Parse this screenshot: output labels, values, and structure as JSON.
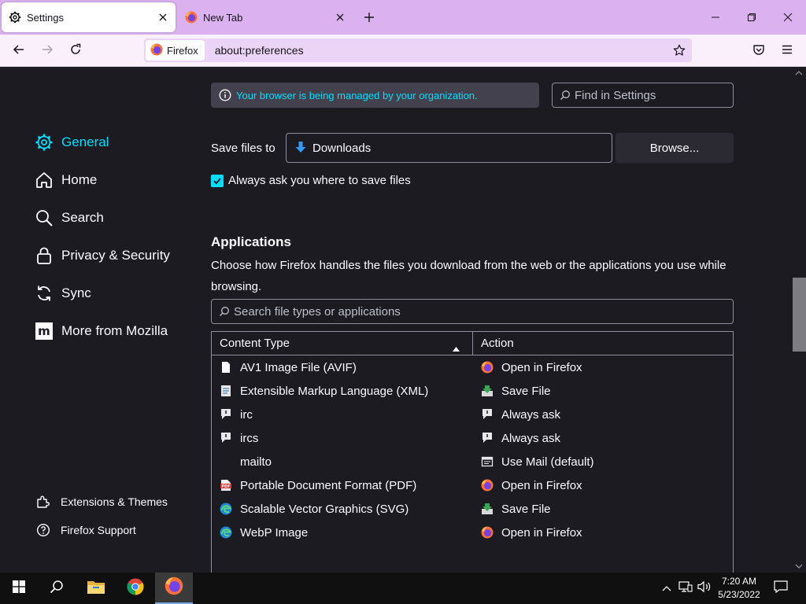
{
  "tabs": [
    {
      "label": "Settings",
      "icon": "gear-icon"
    },
    {
      "label": "New Tab",
      "icon": "firefox-icon"
    }
  ],
  "urlbar": {
    "identity_label": "Firefox",
    "url": "about:preferences"
  },
  "sidebar": {
    "items": [
      {
        "label": "General",
        "icon": "gear-icon",
        "selected": true
      },
      {
        "label": "Home",
        "icon": "home-icon"
      },
      {
        "label": "Search",
        "icon": "search-icon"
      },
      {
        "label": "Privacy & Security",
        "icon": "lock-icon"
      },
      {
        "label": "Sync",
        "icon": "sync-icon"
      },
      {
        "label": "More from Mozilla",
        "icon": "mozilla-icon"
      }
    ],
    "footer": [
      {
        "label": "Extensions & Themes",
        "icon": "puzzle-icon"
      },
      {
        "label": "Firefox Support",
        "icon": "help-icon"
      }
    ]
  },
  "policies_notice": "Your browser is being managed by your organization.",
  "find_placeholder": "Find in Settings",
  "downloads": {
    "save_label": "Save files to",
    "folder": "Downloads",
    "browse_label": "Browse...",
    "always_ask_label": "Always ask you where to save files",
    "always_ask_checked": true
  },
  "applications": {
    "title": "Applications",
    "description": "Choose how Firefox handles the files you download from the web or the applications you use while browsing.",
    "search_placeholder": "Search file types or applications",
    "headers": {
      "content_type": "Content Type",
      "action": "Action"
    },
    "rows": [
      {
        "type": "AV1 Image File (AVIF)",
        "type_icon": "file-icon",
        "action": "Open in Firefox",
        "action_icon": "firefox-icon"
      },
      {
        "type": "Extensible Markup Language (XML)",
        "type_icon": "xml-file-icon",
        "action": "Save File",
        "action_icon": "save-file-icon"
      },
      {
        "type": "irc",
        "type_icon": "chat-icon",
        "action": "Always ask",
        "action_icon": "chat-icon"
      },
      {
        "type": "ircs",
        "type_icon": "chat-icon",
        "action": "Always ask",
        "action_icon": "chat-icon"
      },
      {
        "type": "mailto",
        "type_icon": "",
        "action": "Use Mail (default)",
        "action_icon": "mail-app-icon"
      },
      {
        "type": "Portable Document Format (PDF)",
        "type_icon": "pdf-icon",
        "action": "Open in Firefox",
        "action_icon": "firefox-icon"
      },
      {
        "type": "Scalable Vector Graphics (SVG)",
        "type_icon": "edge-icon",
        "action": "Save File",
        "action_icon": "save-file-icon"
      },
      {
        "type": "WebP Image",
        "type_icon": "edge-icon",
        "action": "Open in Firefox",
        "action_icon": "firefox-icon"
      }
    ]
  },
  "taskbar": {
    "time": "7:20 AM",
    "date": "5/23/2022"
  },
  "colors": {
    "accent": "#00ddff",
    "tabstrip": "#dbb2ef",
    "content_bg": "#1c1b22"
  }
}
